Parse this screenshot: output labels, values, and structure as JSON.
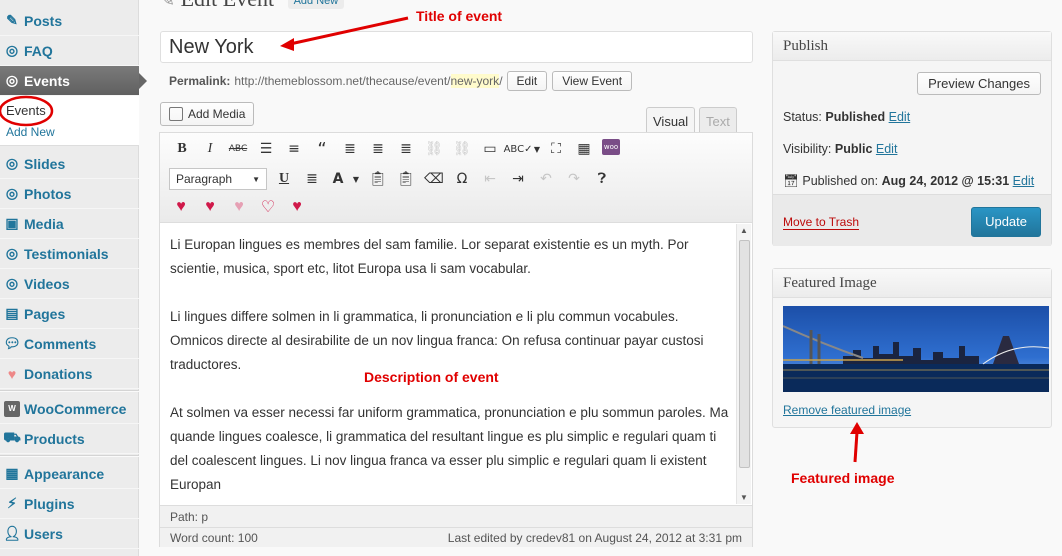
{
  "sidebar": {
    "items": [
      {
        "label": "Posts",
        "icon": "pin-icon"
      },
      {
        "label": "FAQ",
        "icon": "circle-icon"
      },
      {
        "label": "Events",
        "icon": "circle-icon",
        "current": true
      },
      {
        "label": "Slides",
        "icon": "circle-icon"
      },
      {
        "label": "Photos",
        "icon": "circle-icon"
      },
      {
        "label": "Media",
        "icon": "media-icon"
      },
      {
        "label": "Testimonials",
        "icon": "circle-icon"
      },
      {
        "label": "Videos",
        "icon": "circle-icon"
      },
      {
        "label": "Pages",
        "icon": "page-icon"
      },
      {
        "label": "Comments",
        "icon": "comment-icon"
      },
      {
        "label": "Donations",
        "icon": "heart-icon"
      },
      {
        "label": "WooCommerce",
        "icon": "woo-icon"
      },
      {
        "label": "Products",
        "icon": "cart-icon"
      },
      {
        "label": "Appearance",
        "icon": "appearance-icon"
      },
      {
        "label": "Plugins",
        "icon": "plug-icon"
      },
      {
        "label": "Users",
        "icon": "users-icon"
      }
    ],
    "submenu": {
      "events": "Events",
      "add_new": "Add New"
    }
  },
  "header": {
    "title": "Edit Event",
    "add_new": "Add New"
  },
  "title_field": {
    "value": "New York"
  },
  "permalink": {
    "label": "Permalink:",
    "base": "http://themeblossom.net/thecause/event/",
    "slug": "new-york",
    "trail": "/",
    "edit": "Edit",
    "view": "View Event"
  },
  "editor": {
    "add_media": "Add Media",
    "tabs": {
      "visual": "Visual",
      "text": "Text"
    },
    "format": "Paragraph",
    "paragraphs": [
      "Li Europan lingues es membres del sam familie. Lor separat existentie es un myth. Por scientie, musica, sport etc, litot Europa usa li sam vocabular.",
      "Li lingues differe solmen in li grammatica, li pronunciation e li plu commun vocabules. Omnicos directe al desirabilite de un nov lingua franca: On refusa continuar payar custosi traductores.",
      "At solmen va esser necessi far uniform grammatica, pronunciation e plu sommun paroles. Ma quande lingues coalesce, li grammatica del resultant lingue es plu simplic e regulari quam ti del coalescent lingues. Li nov lingua franca va esser plu simplic e regulari quam li existent Europan"
    ],
    "path": "Path: p",
    "word_count": "Word count: 100",
    "last_edited": "Last edited by credev81 on August 24, 2012 at 3:31 pm"
  },
  "publish": {
    "title": "Publish",
    "preview": "Preview Changes",
    "status_label": "Status:",
    "status_value": "Published",
    "visibility_label": "Visibility:",
    "visibility_value": "Public",
    "published_label": "Published on:",
    "published_value": "Aug 24, 2012 @ 15:31",
    "edit": "Edit",
    "trash": "Move to Trash",
    "update": "Update"
  },
  "featured_image": {
    "title": "Featured Image",
    "remove": "Remove featured image"
  },
  "annotations": {
    "title": "Title of event",
    "description": "Description of event",
    "featured": "Featured image"
  },
  "colors": {
    "link": "#21759b",
    "annotation": "#e00000",
    "update_button": "#21759b",
    "trash": "#bc0b0b"
  }
}
